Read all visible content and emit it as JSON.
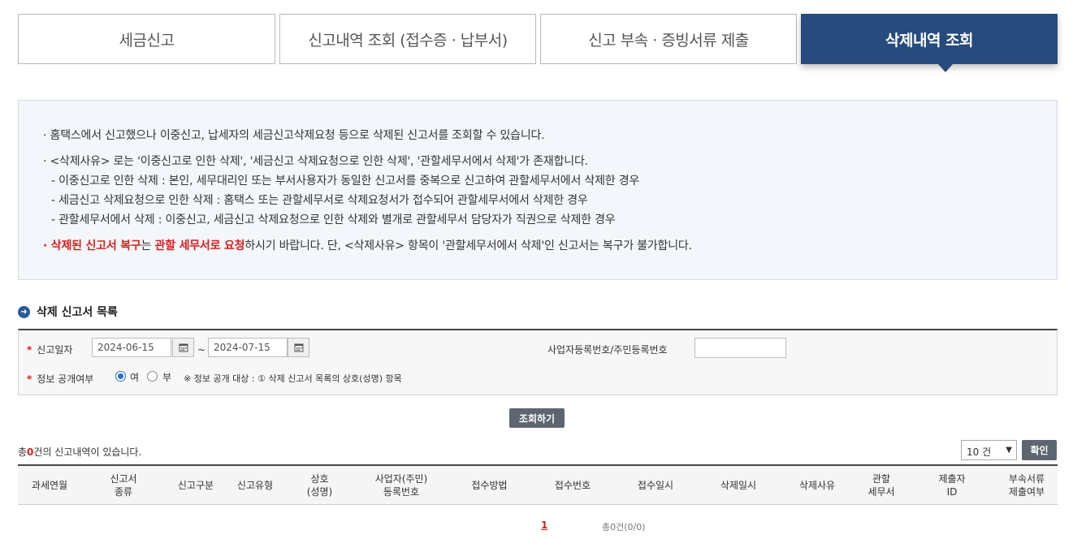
{
  "tabs": [
    {
      "label": "세금신고"
    },
    {
      "label": "신고내역 조회 (접수증 · 납부서)"
    },
    {
      "label": "신고 부속 · 증빙서류 제출"
    },
    {
      "label": "삭제내역 조회",
      "active": true
    }
  ],
  "info": {
    "line1": "홈택스에서 신고했으나 이중신고, 납세자의 세금신고삭제요청 등으로 삭제된 신고서를 조회할 수 있습니다.",
    "line2": "<삭제사유> 로는 '이중신고로 인한 삭제', '세금신고 삭제요청으로 인한 삭제', '관할세무서에서 삭제'가 존재합니다.",
    "sub1": "- 이중신고로 인한 삭제 : 본인, 세무대리인 또는 부서사용자가 동일한 신고서를 중복으로 신고하여 관할세무서에서 삭제한 경우",
    "sub2": "- 세금신고 삭제요청으로 인한 삭제 :  홈택스 또는 관할세무서로 삭제요청서가 접수되어 관할세무서에서 삭제한 경우",
    "sub3": "- 관할세무서에서 삭제 : 이중신고, 세금신고 삭제요청으로 인한 삭제와 별개로 관할세무서 담당자가 직권으로 삭제한 경우",
    "warn_red1": "삭제된 신고서 복구",
    "warn_mid": "는 ",
    "warn_red2": "관할 세무서로 요청",
    "warn_rest": "하시기 바랍니다. 단, <삭제사유> 항목이 '관할세무서에서 삭제'인 신고서는 복구가 불가합니다."
  },
  "section_title": "삭제 신고서 목록",
  "form": {
    "date_label": "신고일자",
    "date_from": "2024-06-15",
    "date_to": "2024-07-15",
    "tilde": "~",
    "id_label": "사업자등록번호/주민등록번호",
    "id_value": "",
    "disclosure_label": "정보 공개여부",
    "radio_yes": "여",
    "radio_no": "부",
    "disclosure_note": "※ 정보 공개 대상 : ① 삭제 신고서 목록의 상호(성명) 항목"
  },
  "query_button": "조회하기",
  "count": {
    "prefix": "총",
    "num": "0",
    "suffix": "건의 신고내역이 있습니다."
  },
  "page_size": {
    "selected": "10 건"
  },
  "ok_button": "확인",
  "table": {
    "headers": [
      "과세연월",
      "신고서\n종류",
      "신고구분",
      "신고유형",
      "상호\n(성명)",
      "사업자(주민)\n등록번호",
      "접수방법",
      "접수번호",
      "접수일시",
      "삭제일시",
      "삭제사유",
      "관할\n세무서",
      "제출자\nID",
      "부속서류\n제출여부"
    ]
  },
  "pager": {
    "page": "1",
    "total": "총0건(0/0)"
  },
  "colors": {
    "accent": "#264b7c",
    "red": "#d61f1f"
  }
}
